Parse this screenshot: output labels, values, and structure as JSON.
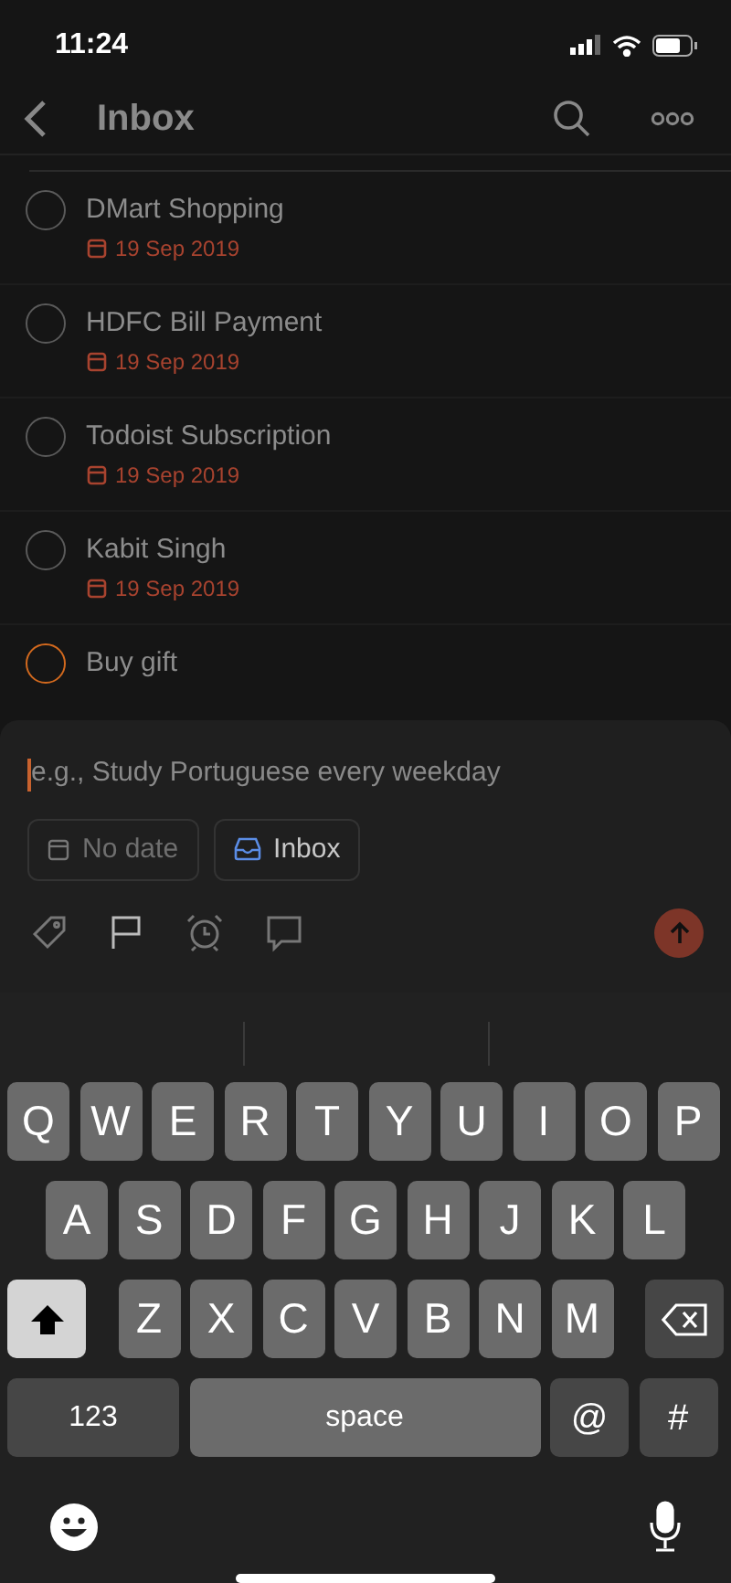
{
  "status_bar": {
    "time": "11:24"
  },
  "header": {
    "title": "Inbox"
  },
  "tasks": [
    {
      "title": "DMart Shopping",
      "date": "19 Sep 2019",
      "color": "#5a5a5a"
    },
    {
      "title": "HDFC Bill Payment",
      "date": "19 Sep 2019",
      "color": "#5a5a5a"
    },
    {
      "title": "Todoist Subscription",
      "date": "19 Sep 2019",
      "color": "#5a5a5a"
    },
    {
      "title": "Kabit Singh",
      "date": "19 Sep 2019",
      "color": "#5a5a5a"
    },
    {
      "title": "Buy gift",
      "color": "#d2691e"
    }
  ],
  "composer": {
    "placeholder": "e.g., Study Portuguese every weekday",
    "chips": [
      {
        "kind": "date",
        "label": "No date"
      },
      {
        "kind": "project",
        "label": "Inbox"
      }
    ]
  },
  "keyboard": {
    "key_lines": [
      [
        {
          "kind": "letter",
          "label": "Q"
        },
        {
          "kind": "letter",
          "label": "W"
        },
        {
          "kind": "letter",
          "label": "E"
        },
        {
          "kind": "letter",
          "label": "R"
        },
        {
          "kind": "letter",
          "label": "T"
        },
        {
          "kind": "letter",
          "label": "Y"
        },
        {
          "kind": "letter",
          "label": "U"
        },
        {
          "kind": "letter",
          "label": "I"
        },
        {
          "kind": "letter",
          "label": "O"
        },
        {
          "kind": "letter",
          "label": "P"
        }
      ],
      [
        {
          "kind": "letter",
          "label": "A"
        },
        {
          "kind": "letter",
          "label": "S"
        },
        {
          "kind": "letter",
          "label": "D"
        },
        {
          "kind": "letter",
          "label": "F"
        },
        {
          "kind": "letter",
          "label": "G"
        },
        {
          "kind": "letter",
          "label": "H"
        },
        {
          "kind": "letter",
          "label": "J"
        },
        {
          "kind": "letter",
          "label": "K"
        },
        {
          "kind": "letter",
          "label": "L"
        }
      ],
      [
        {
          "kind": "shift",
          "on": true
        },
        {
          "kind": "letter",
          "label": "Z"
        },
        {
          "kind": "letter",
          "label": "X"
        },
        {
          "kind": "letter",
          "label": "C"
        },
        {
          "kind": "letter",
          "label": "V"
        },
        {
          "kind": "letter",
          "label": "B"
        },
        {
          "kind": "letter",
          "label": "N"
        },
        {
          "kind": "letter",
          "label": "M"
        },
        {
          "kind": "backspace"
        }
      ],
      [
        {
          "kind": "numbers",
          "label": "123"
        },
        {
          "kind": "space",
          "label": "space"
        },
        {
          "kind": "symbol",
          "label": "@"
        },
        {
          "kind": "symbol",
          "label": "#"
        }
      ]
    ]
  }
}
